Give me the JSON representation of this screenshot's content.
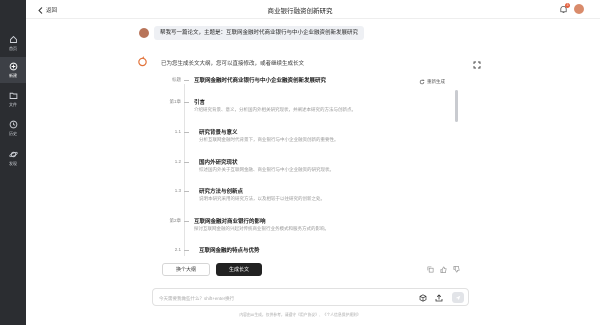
{
  "header": {
    "back_label": "返回",
    "title": "商业银行融资创新研究",
    "notification_count": "3"
  },
  "sidebar": {
    "items": [
      {
        "label": "首页",
        "icon": "home-icon"
      },
      {
        "label": "新建",
        "icon": "new-chat-icon"
      },
      {
        "label": "文件",
        "icon": "folder-icon"
      },
      {
        "label": "历史",
        "icon": "history-icon"
      },
      {
        "label": "发现",
        "icon": "planet-icon"
      }
    ]
  },
  "conversation": {
    "user_message": "帮我写一篇论文，主题是：互联网金融时代商业银行与中小企业融资创新发展研究",
    "assistant_intro": "已为您生成长文大纲，您可以直接修改，或者继续生成长文",
    "regenerate_label": "重新生成",
    "outline": {
      "title_label": "标题",
      "title": "互联网金融时代商业银行与中小企业融资创新发展研究",
      "items": [
        {
          "num": "第1章",
          "title": "引言",
          "desc": "介绍研究背景、意义，分析国内外相关研究现状，并阐述本研究的方法与创新点。"
        },
        {
          "num": "1.1",
          "title": "研究背景与意义",
          "desc": "分析互联网金融时代背景下，商业银行与中小企业融资创新的重要性。"
        },
        {
          "num": "1.2",
          "title": "国内外研究现状",
          "desc": "综述国内外关于互联网金融、商业银行与中小企业融资的研究现状。"
        },
        {
          "num": "1.3",
          "title": "研究方法与创新点",
          "desc": "说明本研究采用的研究方法，以及相较于以往研究的创新之处。"
        },
        {
          "num": "第2章",
          "title": "互联网金融对商业银行的影响",
          "desc": "探讨互联网金融的兴起对传统商业银行业务模式和服务方式的影响。"
        },
        {
          "num": "2.1",
          "title": "互联网金融的特点与优势",
          "desc": ""
        }
      ]
    },
    "actions": {
      "change_outline": "换个大纲",
      "generate_long": "生成长文"
    }
  },
  "composer": {
    "placeholder": "今天需要我做些什么？shift+enter换行"
  },
  "footer": {
    "text": "内容由AI生成，仅供参考，请遵守《用户协议》、《个人信息保护规则》"
  },
  "colors": {
    "sidebar_bg": "#2b2d31",
    "primary_button": "#222222",
    "badge": "#e55f3d"
  }
}
